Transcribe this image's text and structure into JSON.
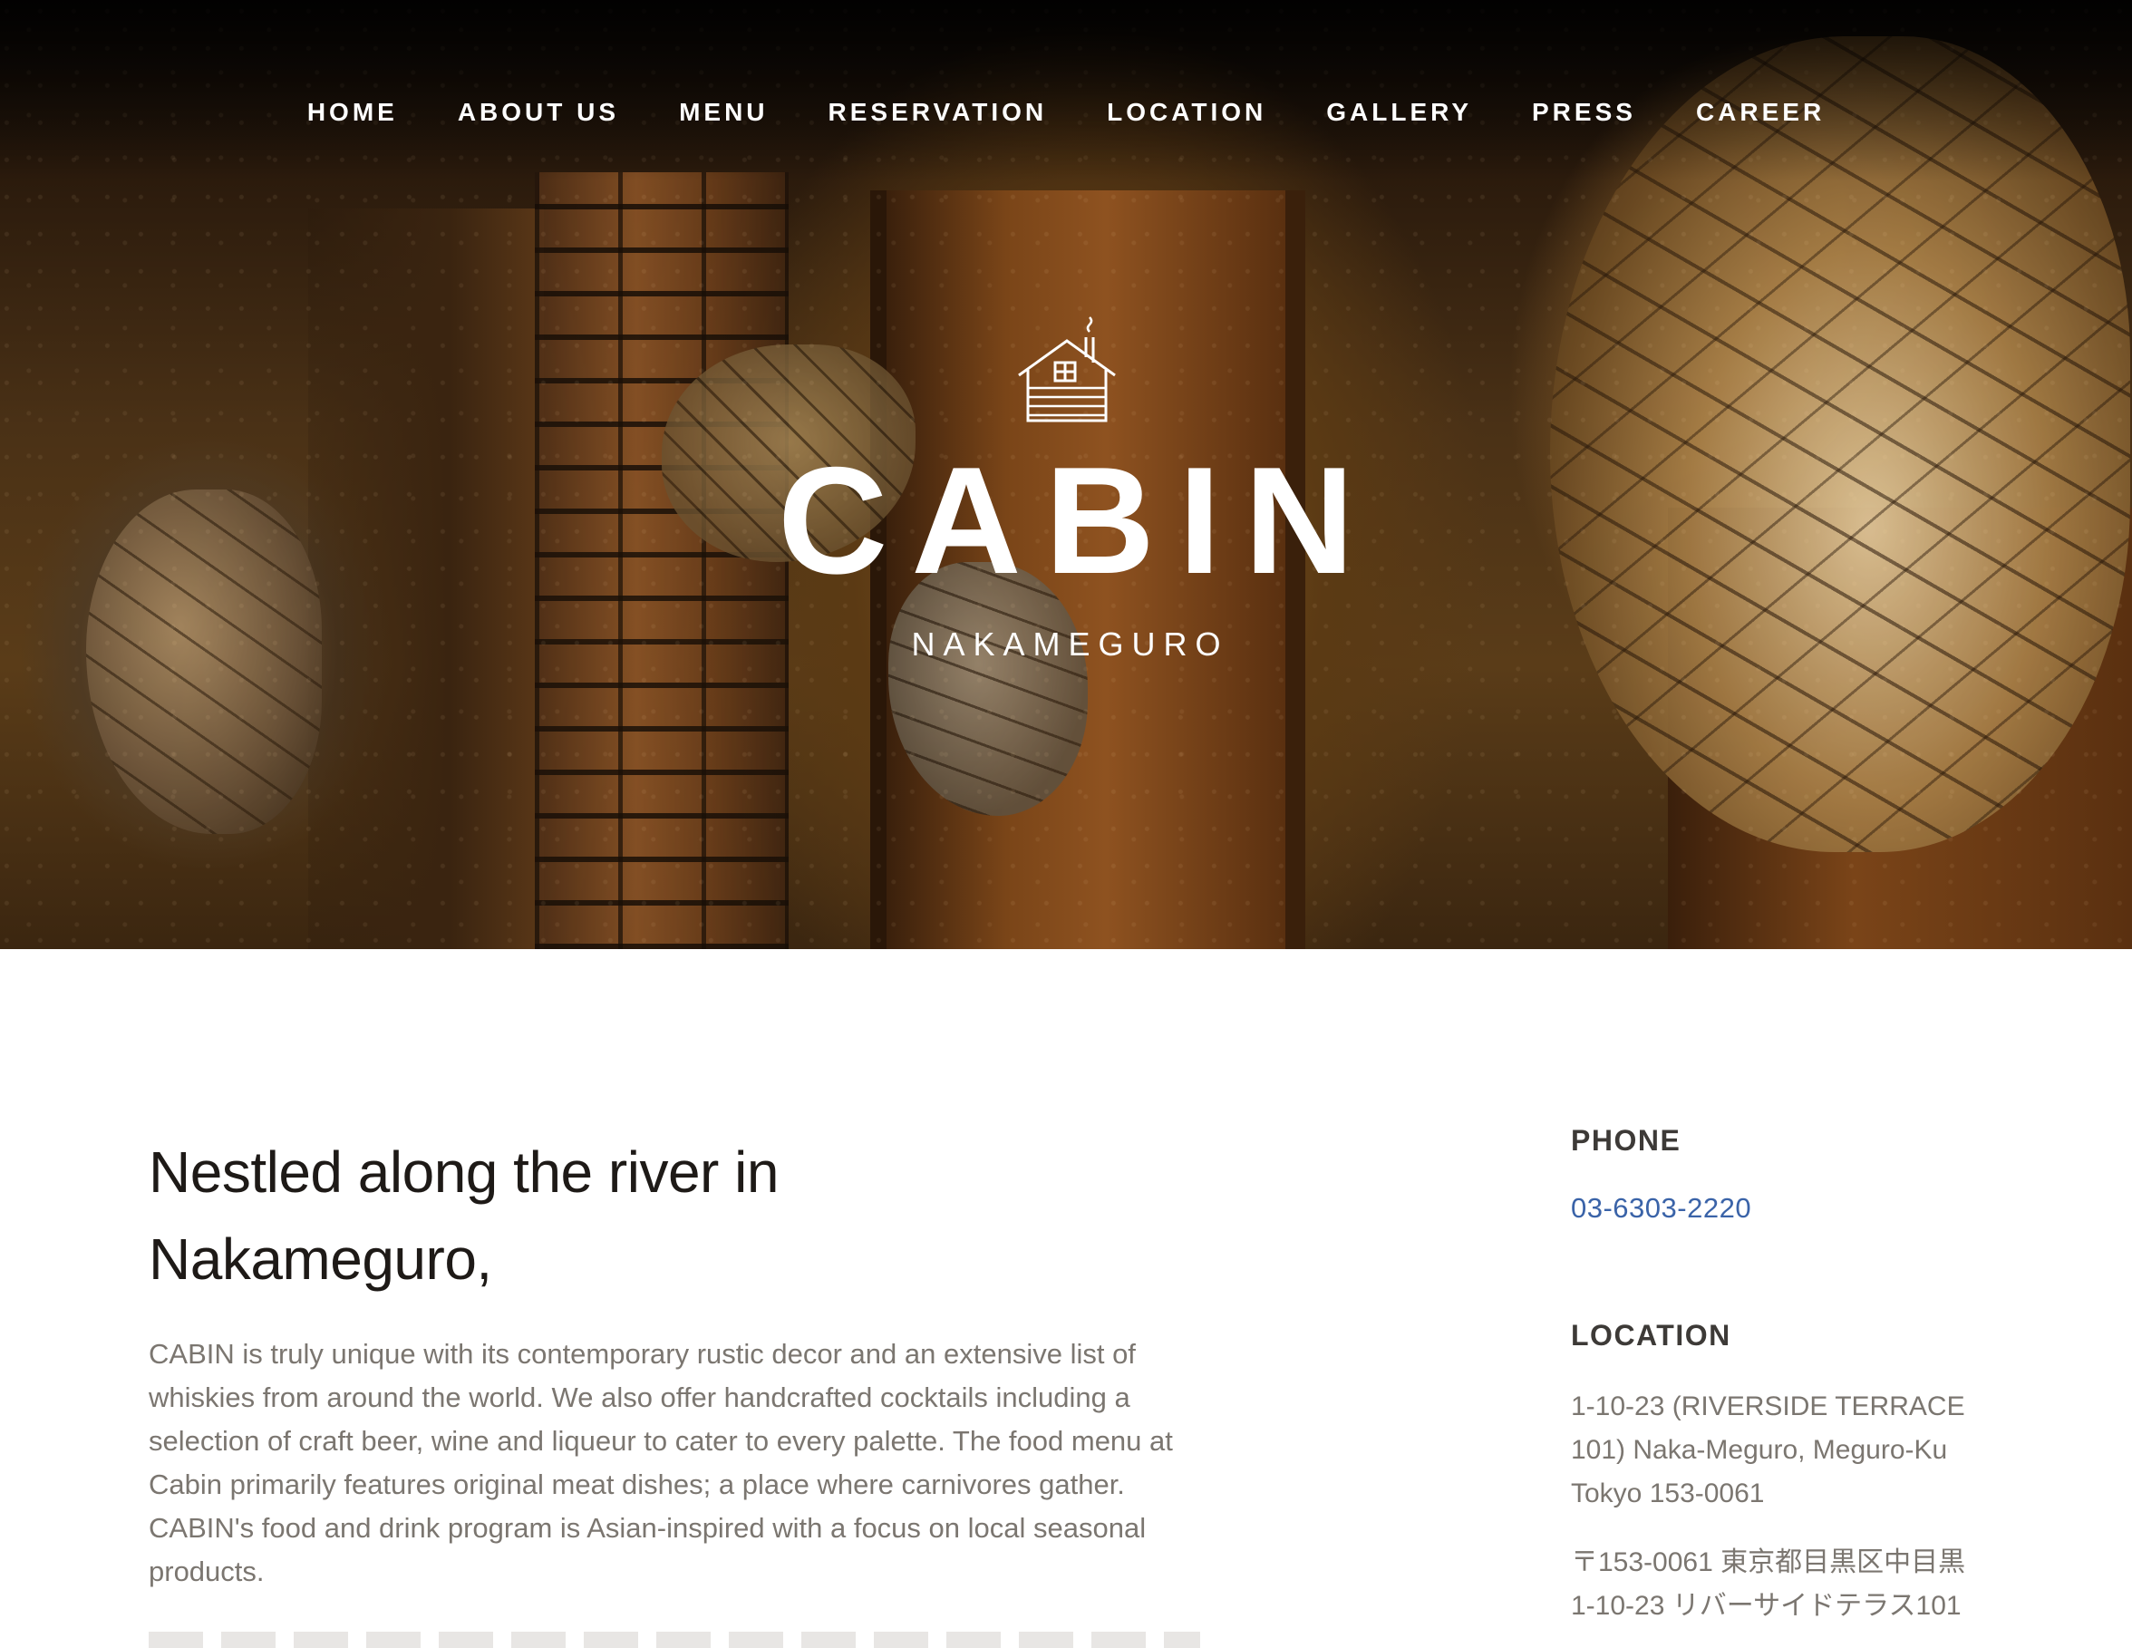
{
  "nav": {
    "items": [
      {
        "label": "HOME"
      },
      {
        "label": "ABOUT US"
      },
      {
        "label": "MENU"
      },
      {
        "label": "RESERVATION"
      },
      {
        "label": "LOCATION"
      },
      {
        "label": "GALLERY"
      },
      {
        "label": "PRESS"
      },
      {
        "label": "CAREER"
      }
    ]
  },
  "hero": {
    "logo_icon": "cabin-house-icon",
    "brand": "CABIN",
    "subtitle": "NAKAMEGURO"
  },
  "intro": {
    "headline_line1": "Nestled along the river in",
    "headline_line2": "Nakameguro,",
    "body": "CABIN is truly unique with its contemporary rustic decor and an extensive list of whiskies from around the world. We also offer handcrafted cocktails including a selection of craft beer, wine and liqueur to cater to every palette. The food menu at Cabin primarily features original meat dishes; a place where carnivores gather. CABIN's food and drink program is Asian-inspired with a focus on local seasonal products."
  },
  "contact": {
    "phone_label": "PHONE",
    "phone": "03-6303-2220",
    "location_label": "LOCATION",
    "address_line1": "1-10-23 (RIVERSIDE TERRACE",
    "address_line2": "101) Naka-Meguro, Meguro-Ku",
    "address_line3": "Tokyo 153-0061",
    "address_jp_line1": "〒153-0061 東京都目黒区中目黒",
    "address_jp_line2": "1-10-23 リバーサイドテラス101"
  },
  "colors": {
    "link": "#3a63a8",
    "heading": "#1e1a17",
    "body": "#7b7670"
  }
}
